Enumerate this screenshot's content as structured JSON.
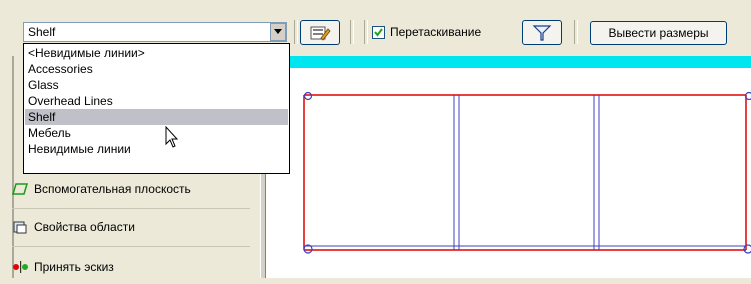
{
  "toolbar": {
    "layer_combo_value": "Shelf",
    "drag_checkbox_label": "Перетаскивание",
    "drag_checked": true,
    "show_dimensions_label": "Вывести размеры"
  },
  "dropdown": {
    "items": [
      "<Невидимые линии>",
      "Accessories",
      "Glass",
      "Overhead Lines",
      "Shelf",
      "Мебель",
      "Невидимые линии"
    ],
    "selected_index": 4
  },
  "panel": {
    "items": [
      {
        "label": "Вспомогательная плоскость",
        "icon": "ref-plane-icon"
      },
      {
        "label": "Свойства области",
        "icon": "region-properties-icon"
      },
      {
        "label": "Принять эскиз",
        "icon": "finish-sketch-icon"
      }
    ]
  },
  "colors": {
    "highlight": "#00e6f0",
    "sketch_red": "#e00000",
    "sketch_blue": "#4040c0"
  }
}
